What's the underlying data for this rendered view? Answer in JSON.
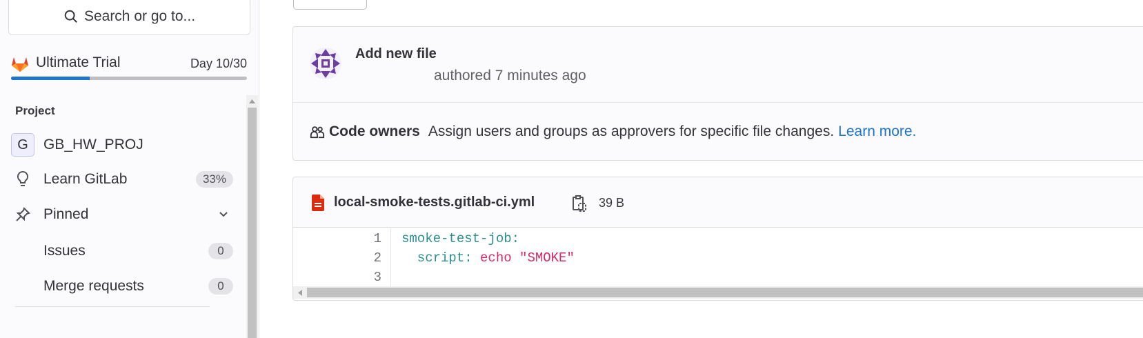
{
  "sidebar": {
    "search_label": "Search or go to...",
    "trial": {
      "title": "Ultimate Trial",
      "day": "Day 10/30",
      "progress": 0.333
    },
    "section_title": "Project",
    "items": [
      {
        "label": "GB_HW_PROJ",
        "avatar_letter": "G"
      },
      {
        "label": "Learn GitLab",
        "badge": "33%"
      },
      {
        "label": "Pinned"
      },
      {
        "label": "Issues",
        "badge": "0"
      },
      {
        "label": "Merge requests",
        "badge": "0"
      }
    ]
  },
  "commit": {
    "title": "Add new file",
    "meta": "authored 7 minutes ago"
  },
  "code_owners": {
    "title": "Code owners",
    "description": "Assign users and groups as approvers for specific file changes.",
    "link": "Learn more."
  },
  "file": {
    "name": "local-smoke-tests.gitlab-ci.yml",
    "size": "39 B",
    "line_numbers": [
      "1",
      "2",
      "3"
    ],
    "lines": [
      {
        "key": "smoke-test-job:",
        "value": ""
      },
      {
        "key": "  script:",
        "value": " echo \"SMOKE\""
      },
      {
        "key": "",
        "value": ""
      }
    ]
  },
  "colors": {
    "accent": "#1f75cb",
    "link": "#1f75cb",
    "code_key": "#2a8f8f",
    "code_string": "#d6296a",
    "file_icon": "#dd2b0e"
  }
}
